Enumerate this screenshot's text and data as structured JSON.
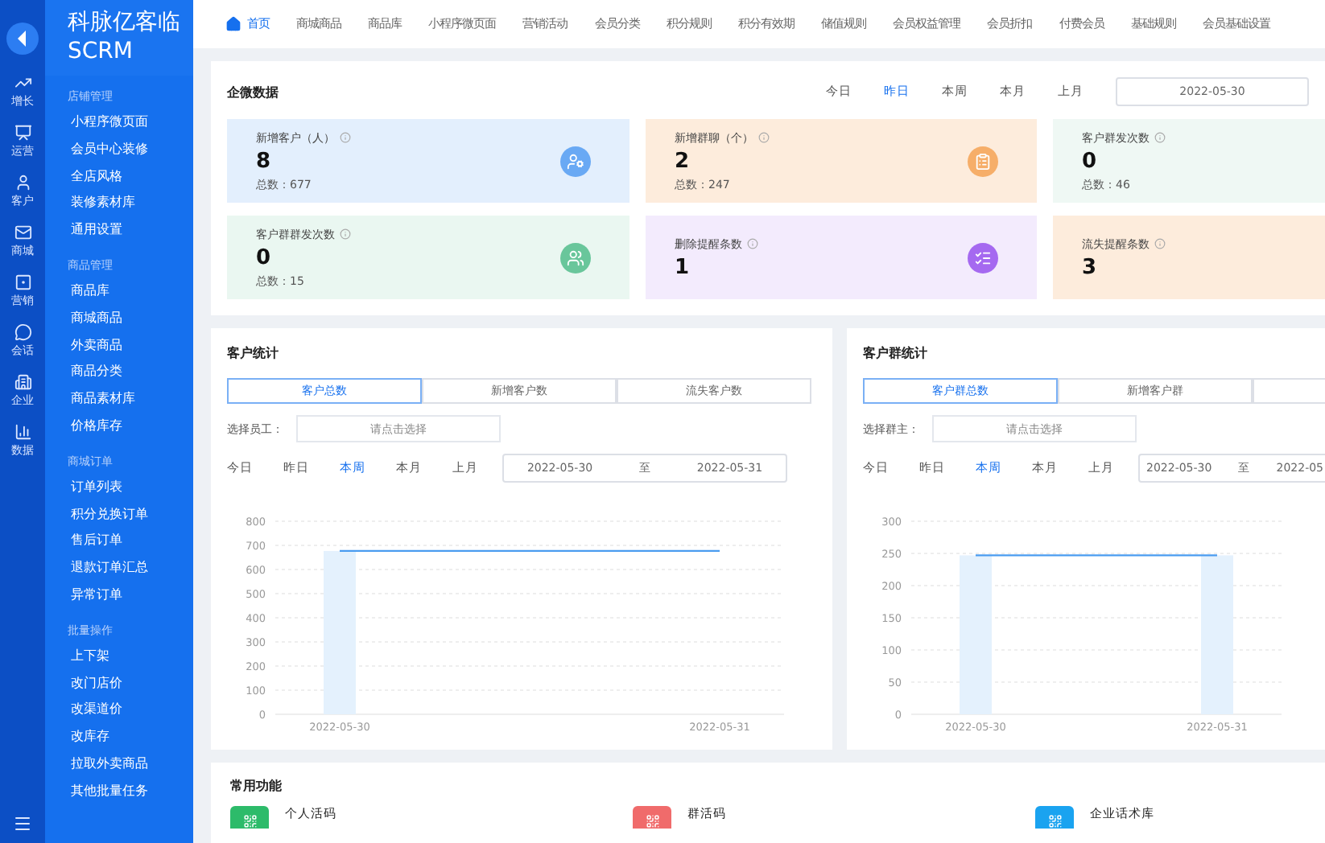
{
  "brand": {
    "title": "科脉亿客临",
    "subtitle": "SCRM"
  },
  "rail": [
    {
      "label": "增长"
    },
    {
      "label": "运营"
    },
    {
      "label": "客户"
    },
    {
      "label": "商城"
    },
    {
      "label": "营销"
    },
    {
      "label": "会话"
    },
    {
      "label": "企业"
    },
    {
      "label": "数据"
    }
  ],
  "menu": [
    {
      "title": "店铺管理",
      "items": [
        "小程序微页面",
        "会员中心装修",
        "全店风格",
        "装修素材库",
        "通用设置"
      ]
    },
    {
      "title": "商品管理",
      "items": [
        "商品库",
        "商城商品",
        "外卖商品",
        "商品分类",
        "商品素材库",
        "价格库存"
      ]
    },
    {
      "title": "商城订单",
      "items": [
        "订单列表",
        "积分兑换订单",
        "售后订单",
        "退款订单汇总",
        "异常订单"
      ]
    },
    {
      "title": "批量操作",
      "items": [
        "上下架",
        "改门店价",
        "改渠道价",
        "改库存",
        "拉取外卖商品",
        "其他批量任务"
      ]
    }
  ],
  "nav": [
    {
      "label": "首页",
      "selected": true
    },
    {
      "label": "商城商品",
      "selected": false
    },
    {
      "label": "商品库",
      "selected": false
    },
    {
      "label": "小程序微页面",
      "selected": false
    },
    {
      "label": "营销活动",
      "selected": false
    },
    {
      "label": "会员分类",
      "selected": false
    },
    {
      "label": "积分规则",
      "selected": false
    },
    {
      "label": "积分有效期",
      "selected": false
    },
    {
      "label": "储值规则",
      "selected": false
    },
    {
      "label": "会员权益管理",
      "selected": false
    },
    {
      "label": "会员折扣",
      "selected": false
    },
    {
      "label": "付费会员",
      "selected": false
    },
    {
      "label": "基础规则",
      "selected": false
    },
    {
      "label": "会员基础设置",
      "selected": false
    }
  ],
  "wecom": {
    "title": "企微数据",
    "periods": [
      {
        "label": "今日",
        "selected": false
      },
      {
        "label": "昨日",
        "selected": true
      },
      {
        "label": "本周",
        "selected": false
      },
      {
        "label": "本月",
        "selected": false
      },
      {
        "label": "上月",
        "selected": false
      }
    ],
    "date_start": "2022-05-30",
    "cards": [
      {
        "kind": "icon",
        "label": "新增客户（人）",
        "value": "8",
        "total": "总数：677",
        "color": "#e3effd"
      },
      {
        "kind": "icon",
        "label": "新增群聊（个）",
        "value": "2",
        "total": "总数：247",
        "color": "#fdecdc"
      },
      {
        "kind": "plain",
        "label": "客户群发次数",
        "value": "0",
        "total": "总数：46",
        "color": "#eff8f4"
      },
      {
        "kind": "icon",
        "label": "客户群群发次数",
        "value": "0",
        "total": "总数：15",
        "color": "#eaf7f1"
      },
      {
        "kind": "icon",
        "label": "删除提醒条数",
        "value": "1",
        "color": "#f3ebfd"
      },
      {
        "kind": "plain",
        "label": "流失提醒条数",
        "value": "3",
        "color": "#fdecdc"
      }
    ]
  },
  "stats": [
    {
      "title": "客户统计",
      "tabs": [
        {
          "label": "客户总数",
          "selected": true
        },
        {
          "label": "新增客户数",
          "selected": false
        },
        {
          "label": "流失客户数",
          "selected": false
        }
      ],
      "picker_label": "选择员工：",
      "picker_placeholder": "请点击选择",
      "periods": [
        {
          "label": "今日",
          "selected": false
        },
        {
          "label": "昨日",
          "selected": false
        },
        {
          "label": "本周",
          "selected": true
        },
        {
          "label": "本月",
          "selected": false
        },
        {
          "label": "上月",
          "selected": false
        }
      ],
      "date_start": "2022-05-30",
      "date_sep": "至",
      "date_end": "2022-05-31",
      "chart_data": {
        "type": "bar",
        "categories": [
          "2022-05-30",
          "2022-05-31"
        ],
        "ylim": [
          0,
          800
        ],
        "yticks": [
          0,
          100,
          200,
          300,
          400,
          500,
          600,
          700,
          800
        ],
        "series": [
          {
            "type": "bar",
            "color": "#e4f1fd",
            "values": [
              677,
              null
            ]
          },
          {
            "type": "line",
            "color": "#4a9cf0",
            "values": [
              677,
              677
            ]
          }
        ]
      }
    },
    {
      "title": "客户群统计",
      "tabs": [
        {
          "label": "客户群总数",
          "selected": true
        },
        {
          "label": "新增客户群",
          "selected": false
        },
        {
          "selected": false
        }
      ],
      "picker_label": "选择群主：",
      "picker_placeholder": "请点击选择",
      "periods": [
        {
          "label": "今日",
          "selected": false
        },
        {
          "label": "昨日",
          "selected": false
        },
        {
          "label": "本周",
          "selected": true
        },
        {
          "label": "本月",
          "selected": false
        },
        {
          "label": "上月",
          "selected": false
        }
      ],
      "date_start": "2022-05-30",
      "date_sep": "至",
      "date_end": "2022-05",
      "chart_data": {
        "type": "bar",
        "categories": [
          "2022-05-30",
          "2022-05-31"
        ],
        "ylim": [
          0,
          300
        ],
        "yticks": [
          0,
          50,
          100,
          150,
          200,
          250,
          300
        ],
        "series": [
          {
            "type": "bar",
            "color": "#e4f1fd",
            "values": [
              247,
              247
            ]
          },
          {
            "type": "line",
            "color": "#4a9cf0",
            "values": [
              247,
              247
            ]
          }
        ]
      }
    }
  ],
  "functions": {
    "title": "常用功能",
    "items": [
      {
        "label": "个人活码",
        "color": "#2dbb6a"
      },
      {
        "label": "群活码",
        "color": "#f06b6b"
      },
      {
        "label": "企业话术库",
        "color": "#1aa3f0"
      }
    ]
  }
}
